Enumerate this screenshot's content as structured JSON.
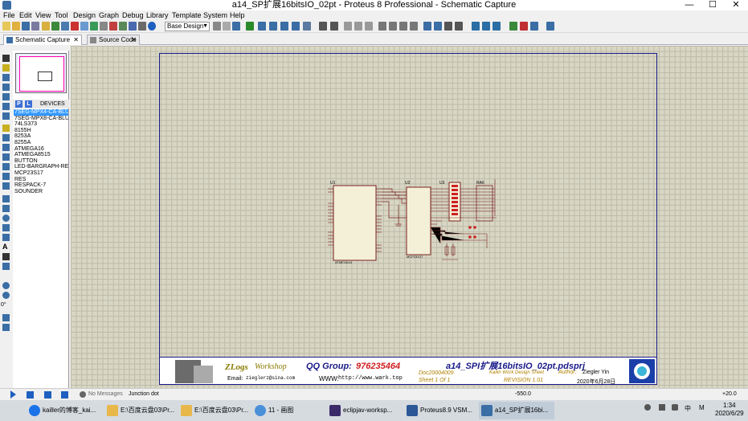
{
  "window": {
    "title": "a14_SP扩展16bitsIO_02pt - Proteus 8 Professional - Schematic Capture",
    "minimize": "—",
    "maximize": "☐",
    "close": "✕"
  },
  "menu": [
    "File",
    "Edit",
    "View",
    "Tool",
    "Design",
    "Graph",
    "Debug",
    "Library",
    "Template",
    "System",
    "Help"
  ],
  "toolbar": {
    "design_select": "Base Design"
  },
  "tabs": [
    {
      "label": "Schematic Capture",
      "active": true
    },
    {
      "label": "Source Code",
      "active": false
    }
  ],
  "panel": {
    "p_button": "P",
    "l_button": "L",
    "devices_label": "DEVICES",
    "devices": [
      "7SEG-MPX4-CA-BLUE",
      "7SEG-MPX8-CA-BLUE",
      "74LS373",
      "8155H",
      "8253A",
      "8255A",
      "ATMEGA16",
      "ATMEGA8515",
      "BUTTON",
      "LED-BARGRAPH-RED",
      "MCP23S17",
      "RES",
      "RESPACK-7",
      "SOUNDER"
    ],
    "selected_index": 0,
    "rotation_label": "0°"
  },
  "schematic": {
    "u1_label": "U1",
    "u2_label": "U2",
    "u3_label": "U3",
    "ra_label": "RA6",
    "u1_name": "ATMEGA16",
    "u2_name": "MCP23S17"
  },
  "titleblock": {
    "logo": "ZLogs",
    "logo2": "Workshop",
    "qq_label": "QQ Group:",
    "qq_number": "976235464",
    "email_label": "Email:",
    "email": "zieglerz@sina.com",
    "www_label": "WWW:",
    "www": "http://www.wark.top",
    "project": "a14_SPI扩展16bitsIO_02pt.pdsprj",
    "doc": "Doc20004009",
    "kailin": "Kailin Work Design Sheet",
    "author_label": "Author:",
    "author": "Ziegler Yin",
    "sheet": "Sheet   1    Of   1",
    "revision": "REVISION  1.01",
    "date": "2020年6月28日"
  },
  "status": {
    "messages": "No Messages",
    "tip": "Junction dot",
    "x": "-550.0",
    "y": "+20.0"
  },
  "taskbar": [
    {
      "label": "kailler的博客_kai...",
      "color": "#1a73e8"
    },
    {
      "label": "E:\\百度云盘03\\Pr...",
      "color": "#e8b84a"
    },
    {
      "label": "E:\\百度云盘03\\Pr...",
      "color": "#e8b84a"
    },
    {
      "label": "11 - 画图",
      "color": "#4a90d9"
    },
    {
      "label": "eclipjav-worksp...",
      "color": "#3a2a6a"
    },
    {
      "label": "Proteus8.9 VSM...",
      "color": "#2b5797"
    },
    {
      "label": "a14_SP扩展16bi...",
      "color": "#3a6ea5"
    }
  ],
  "tray": {
    "ime": "中",
    "m": "M",
    "time": "1:34",
    "date": "2020/6/29"
  }
}
